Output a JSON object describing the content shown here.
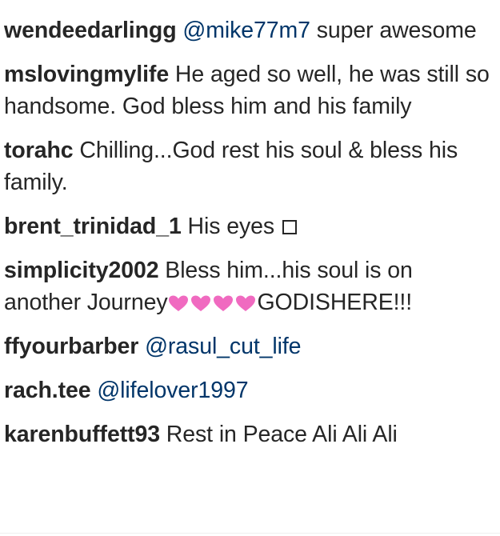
{
  "comments": [
    {
      "username": "wendeedarlingg",
      "mention": "@mike77m7",
      "text": " super awesome"
    },
    {
      "username": "mslovingmylife",
      "text": " He aged so well, he was still so handsome. God bless him and his family"
    },
    {
      "username": "torahc",
      "text": " Chilling...God rest his soul & bless his family."
    },
    {
      "username": "brent_trinidad_1",
      "text": " His eyes ",
      "icon": "missing-glyph-box-icon"
    },
    {
      "username": "simplicity2002",
      "text": " Bless him...his soul is on another Journey",
      "icon": "sparkling-hearts-icon",
      "text_after": "GODISHERE!!!"
    },
    {
      "username": "ffyourbarber",
      "mention": "@rasul_cut_life"
    },
    {
      "username": "rach.tee",
      "mention": "@lifelover1997"
    },
    {
      "username": "karenbuffett93",
      "text": " Rest in Peace Ali Ali Ali"
    }
  ],
  "colors": {
    "text": "#262626",
    "mention": "#003569",
    "heart_pink": "#f06ac0"
  }
}
